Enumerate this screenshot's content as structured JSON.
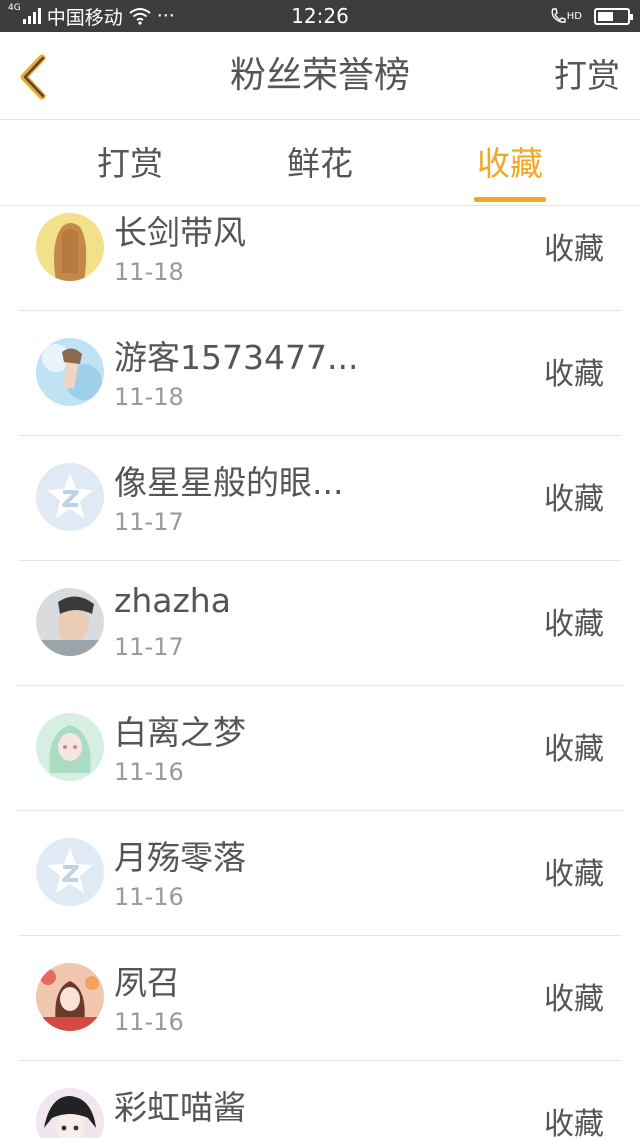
{
  "status_bar": {
    "network": "4G",
    "carrier": "中国移动",
    "more": "···",
    "time": "12:26",
    "call_badge": "HD",
    "battery_level": 0.55
  },
  "header": {
    "title": "粉丝荣誉榜",
    "action_label": "打赏",
    "accent_color": "#f5a623"
  },
  "tabs": [
    {
      "label": "打赏",
      "active": false
    },
    {
      "label": "鲜花",
      "active": false
    },
    {
      "label": "收藏",
      "active": true
    }
  ],
  "list": [
    {
      "name": "长剑带风",
      "date": "11-18",
      "action": "收藏",
      "avatar": "long-hair-girl-avatar"
    },
    {
      "name": "游客1573477...",
      "date": "11-18",
      "action": "收藏",
      "avatar": "anime-girl-avatar"
    },
    {
      "name": "像星星般的眼...",
      "date": "11-17",
      "action": "收藏",
      "avatar": "qq-default-avatar"
    },
    {
      "name": "zhazha",
      "date": "11-17",
      "action": "收藏",
      "avatar": "photo-man-avatar"
    },
    {
      "name": "白离之梦",
      "date": "11-16",
      "action": "收藏",
      "avatar": "green-anime-avatar"
    },
    {
      "name": "月殇零落",
      "date": "11-16",
      "action": "收藏",
      "avatar": "qq-default-avatar"
    },
    {
      "name": "夙召",
      "date": "11-16",
      "action": "收藏",
      "avatar": "red-anime-avatar"
    },
    {
      "name": "彩虹喵酱",
      "date": "",
      "action": "收藏",
      "avatar": "dark-anime-avatar"
    }
  ]
}
